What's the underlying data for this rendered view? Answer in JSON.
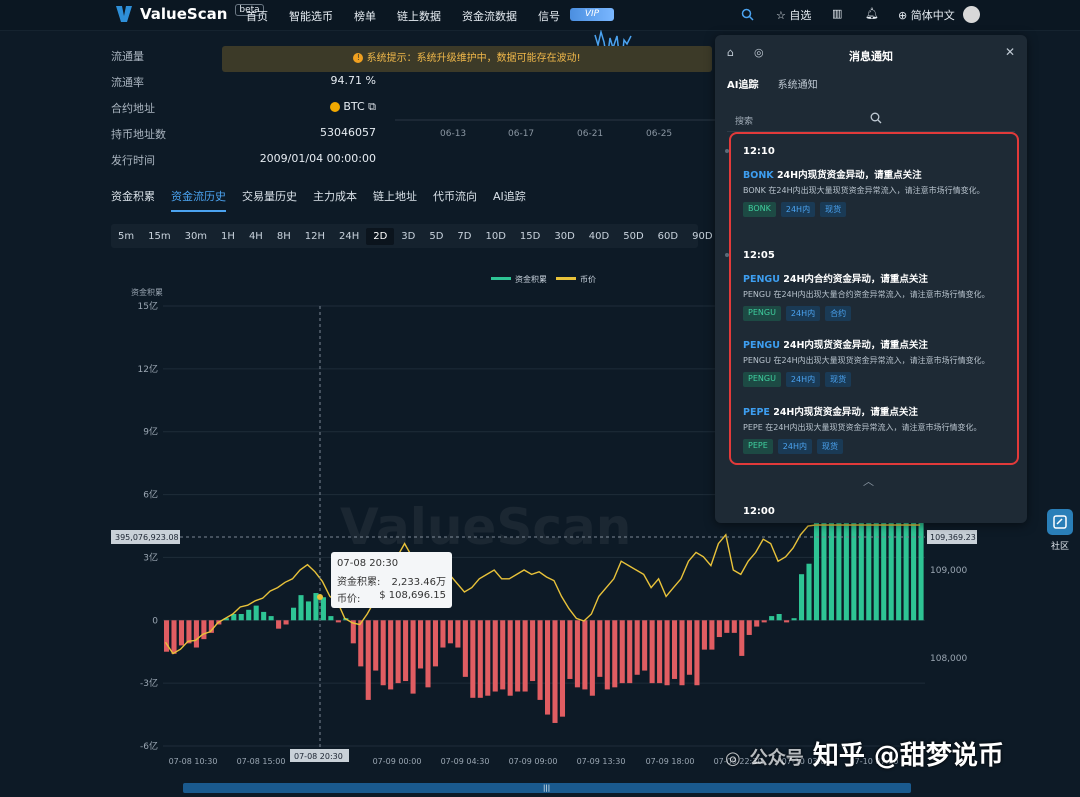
{
  "nav": {
    "brand": "ValueScan",
    "beta": "beta",
    "menu": [
      "首页",
      "智能选币",
      "榜单",
      "链上数据",
      "资金流数据",
      "信号"
    ],
    "vip": "VIP",
    "watchlist": "自选",
    "language": "简体中文"
  },
  "info": [
    {
      "label": "流通量",
      "value": ""
    },
    {
      "label": "流通率",
      "value": "94.71 %"
    },
    {
      "label": "合约地址",
      "value": "BTC"
    },
    {
      "label": "持币地址数",
      "value": "53046057"
    },
    {
      "label": "发行时间",
      "value": "2009/01/04 00:00:00"
    }
  ],
  "notice": "系统提示：系统升级维护中，数据可能存在波动!",
  "mini_dates": [
    "06-13",
    "06-17",
    "06-21",
    "06-25"
  ],
  "tabs": [
    "资金积累",
    "资金流历史",
    "交易量历史",
    "主力成本",
    "链上地址",
    "代币流向",
    "AI追踪"
  ],
  "timeframes": [
    "5m",
    "15m",
    "30m",
    "1H",
    "4H",
    "8H",
    "12H",
    "24H",
    "2D",
    "3D",
    "5D",
    "7D",
    "10D",
    "15D",
    "30D",
    "40D",
    "50D",
    "60D",
    "90D"
  ],
  "active_timeframe": "2D",
  "chart_data": {
    "type": "bar+line",
    "legend": [
      "资金积累",
      "币价"
    ],
    "ylabel_left": "资金积累",
    "left_ticks": [
      "15亿",
      "12亿",
      "9亿",
      "6亿",
      "3亿",
      "0",
      "-3亿",
      "-6亿"
    ],
    "right_ticks": [
      "109,000",
      "108,000"
    ],
    "x_ticks": [
      "07-08 10:30",
      "07-08 15:00",
      "07-09 00:00",
      "07-09 04:30",
      "07-09 09:00",
      "07-09 13:30",
      "07-09 18:00",
      "07-09 22:30",
      "07-10 03:00",
      "07-10 07:30"
    ],
    "crosshair_left": "395,076,923.08",
    "crosshair_right": "109,369.23",
    "crosshair_x": "07-08 20:30",
    "bars_yi": [
      -1.5,
      -1.6,
      -1.2,
      -1.1,
      -1.3,
      -0.9,
      -0.6,
      -0.2,
      0.1,
      0.3,
      0.3,
      0.5,
      0.7,
      0.4,
      0.2,
      -0.4,
      -0.2,
      0.6,
      1.2,
      0.9,
      1.3,
      1.1,
      0.2,
      -0.1,
      0.1,
      -1.1,
      -2.2,
      -3.8,
      -2.4,
      -3.1,
      -3.3,
      -3.0,
      -2.9,
      -3.5,
      -2.3,
      -3.2,
      -2.2,
      -1.3,
      -1.1,
      -1.3,
      -2.7,
      -3.7,
      -3.7,
      -3.6,
      -3.4,
      -3.3,
      -3.6,
      -3.4,
      -3.4,
      -2.9,
      -3.8,
      -4.5,
      -4.9,
      -4.6,
      -2.8,
      -3.2,
      -3.3,
      -3.6,
      -2.7,
      -3.3,
      -3.2,
      -3.0,
      -3.0,
      -2.6,
      -2.4,
      -3.0,
      -3.0,
      -3.1,
      -2.8,
      -3.1,
      -2.6,
      -3.1,
      -1.4,
      -1.4,
      -0.8,
      -0.6,
      -0.6,
      -1.7,
      -0.7,
      -0.3,
      -0.1,
      0.2,
      0.3,
      -0.1,
      0.1,
      2.2,
      2.7,
      4.9,
      4.9,
      4.9,
      4.9,
      4.9,
      4.9,
      4.9,
      4.9,
      4.9,
      4.9,
      4.9,
      4.9,
      4.9,
      4.9,
      4.9
    ],
    "price": [
      108180,
      108050,
      108100,
      108190,
      108200,
      108270,
      108300,
      108400,
      108450,
      108500,
      108580,
      108600,
      108650,
      108680,
      108760,
      108800,
      108860,
      108900,
      109000,
      109060,
      108980,
      108870,
      108700,
      108640,
      108450,
      108400,
      108380,
      108500,
      108650,
      108850,
      108900,
      109150,
      109300,
      109150,
      109050,
      108950,
      108950,
      108880,
      108950,
      108850,
      108750,
      108800,
      108900,
      108950,
      109000,
      108900,
      108900,
      108950,
      109000,
      108950,
      108980,
      108920,
      108880,
      108700,
      108560,
      108450,
      108420,
      108500,
      108700,
      108800,
      108900,
      109100,
      109050,
      109000,
      108950,
      108800,
      108900,
      108700,
      108800,
      108900,
      109100,
      109200,
      109150,
      109050,
      109300,
      109400,
      109000,
      108950,
      109100,
      109200,
      109350,
      109300,
      109100,
      109150,
      109250,
      109400,
      109500,
      109600,
      109700,
      109700,
      109700,
      109700,
      109700,
      109700,
      109700,
      109700,
      109700,
      109700,
      109700,
      109700,
      109700,
      109700
    ]
  },
  "tooltip": {
    "time": "07-08 20:30",
    "flow_label": "资金积累:",
    "flow_value": "2,233.46万",
    "price_label": "币价:",
    "price_value": "$ 108,696.15"
  },
  "watermark": "ValueScan",
  "panel": {
    "title": "消息通知",
    "tabs": [
      "AI追踪",
      "系统通知"
    ],
    "search_placeholder": "搜索",
    "groups": [
      {
        "time": "12:10",
        "items": [
          {
            "coin": "BONK",
            "title": " 24H内现货资金异动，请重点关注",
            "desc": "BONK 在24H内出现大量现货资金异常流入，请注意市场行情变化。",
            "tags": [
              "BONK",
              "24H内",
              "现货"
            ]
          }
        ]
      },
      {
        "time": "12:05",
        "items": [
          {
            "coin": "PENGU",
            "title": " 24H内合约资金异动，请重点关注",
            "desc": "PENGU 在24H内出现大量合约资金异常流入，请注意市场行情变化。",
            "tags": [
              "PENGU",
              "24H内",
              "合约"
            ]
          },
          {
            "coin": "PENGU",
            "title": " 24H内现货资金异动，请重点关注",
            "desc": "PENGU 在24H内出现大量现货资金异常流入，请注意市场行情变化。",
            "tags": [
              "PENGU",
              "24H内",
              "现货"
            ]
          },
          {
            "coin": "PEPE",
            "title": " 24H内现货资金异动，请重点关注",
            "desc": "PEPE 在24H内出现大量现货资金异常流入，请注意市场行情变化。",
            "tags": [
              "PEPE",
              "24H内",
              "现货"
            ]
          }
        ]
      }
    ],
    "next_time": "12:00"
  },
  "community": "社区",
  "credit": "知乎 @甜梦说币",
  "credit_prefix": "公众号"
}
